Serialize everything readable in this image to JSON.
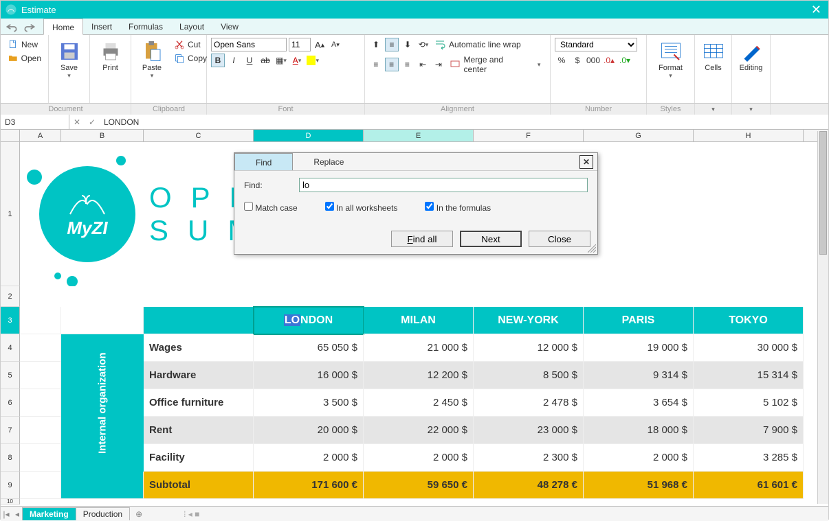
{
  "window": {
    "title": "Estimate"
  },
  "menus": {
    "home": "Home",
    "insert": "Insert",
    "formulas": "Formulas",
    "layout": "Layout",
    "view": "View"
  },
  "ribbon": {
    "new": "New",
    "open": "Open",
    "save": "Save",
    "print": "Print",
    "paste": "Paste",
    "cut": "Cut",
    "copy": "Copy",
    "font_name": "Open Sans",
    "font_size": "11",
    "autowrap": "Automatic line wrap",
    "merge": "Merge and center",
    "numfmt": "Standard",
    "format": "Format",
    "cells": "Cells",
    "editing": "Editing",
    "groups": {
      "document": "Document",
      "clipboard": "Clipboard",
      "font": "Font",
      "alignment": "Alignment",
      "number": "Number",
      "styles": "Styles"
    }
  },
  "formula_bar": {
    "cell": "D3",
    "value": "LONDON"
  },
  "columns": [
    "A",
    "B",
    "C",
    "D",
    "E",
    "F",
    "G",
    "H"
  ],
  "page_title": "OPERATIONAL SUMMARY",
  "vcat_label": "Internal organization",
  "headers": [
    "LONDON",
    "MILAN",
    "NEW-YORK",
    "PARIS",
    "TOKYO"
  ],
  "rows": [
    {
      "label": "Wages",
      "vals": [
        "65 050 $",
        "21 000 $",
        "12 000 $",
        "19 000 $",
        "30 000 $"
      ],
      "alt": false
    },
    {
      "label": "Hardware",
      "vals": [
        "16 000 $",
        "12 200 $",
        "8 500 $",
        "9 314 $",
        "15 314 $"
      ],
      "alt": true
    },
    {
      "label": "Office furniture",
      "vals": [
        "3 500 $",
        "2 450 $",
        "2 478 $",
        "3 654 $",
        "5 102 $"
      ],
      "alt": false
    },
    {
      "label": "Rent",
      "vals": [
        "20 000 $",
        "22 000 $",
        "23 000 $",
        "18 000 $",
        "7 900 $"
      ],
      "alt": true
    },
    {
      "label": "Facility",
      "vals": [
        "2 000 $",
        "2 000 $",
        "2 300 $",
        "2 000 $",
        "3 285 $"
      ],
      "alt": false
    }
  ],
  "subtotal": {
    "label": "Subtotal",
    "vals": [
      "171 600 €",
      "59 650 €",
      "48 278 €",
      "51 968 €",
      "61 601 €"
    ]
  },
  "sheets": {
    "active": "Marketing",
    "other": "Production"
  },
  "dialog": {
    "find_tab": "Find",
    "replace_tab": "Replace",
    "find_label": "Find:",
    "find_value": "lo",
    "match_case": "Match case",
    "in_ws": "In all worksheets",
    "in_form": "In the formulas",
    "find_all": "Find all",
    "next": "Next",
    "close": "Close"
  },
  "logo_text": "MyZI"
}
